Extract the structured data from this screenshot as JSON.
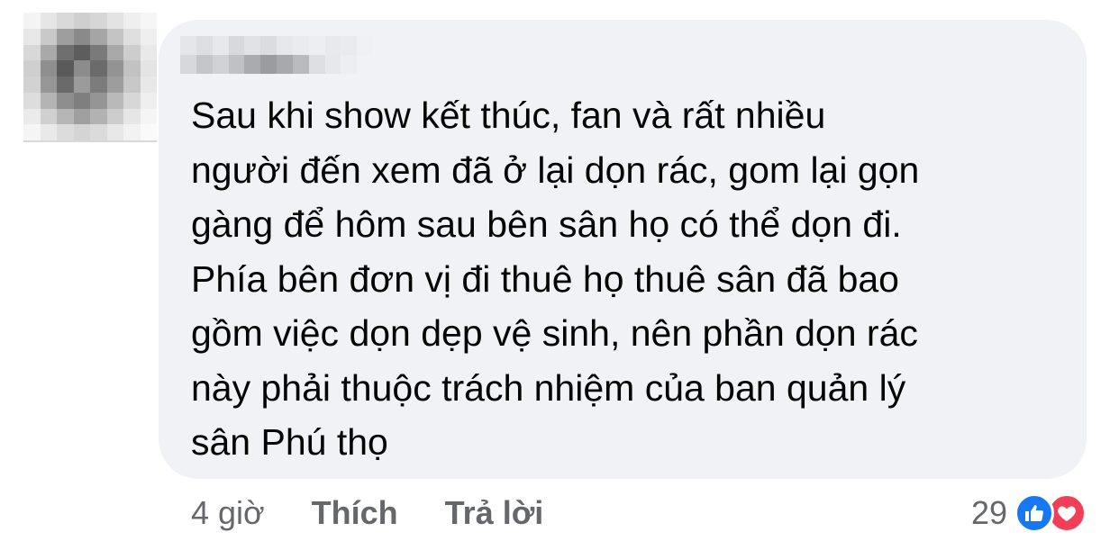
{
  "comment": {
    "lines": [
      "Sau khi show kết thúc, fan và rất nhiều",
      "người đến xem đã ở lại dọn rác, gom lại gọn",
      "gàng để hôm sau bên sân họ có thể dọn đi.",
      "Phía bên đơn vị đi thuê họ thuê sân đã bao",
      "gồm việc dọn dẹp vệ sinh, nên phần dọn rác",
      "này phải thuộc trách nhiệm của ban quản lý",
      "sân Phú thọ"
    ]
  },
  "actions": {
    "time": "4 giờ",
    "like_label": "Thích",
    "reply_label": "Trả lời"
  },
  "reactions": {
    "count": "29",
    "icons": [
      "like-icon",
      "love-icon"
    ],
    "like_color": "#1877f2",
    "love_color": "#f33e58"
  },
  "colors": {
    "bubble": "#f0f2f5",
    "text": "#050505",
    "secondary": "#65676b"
  }
}
